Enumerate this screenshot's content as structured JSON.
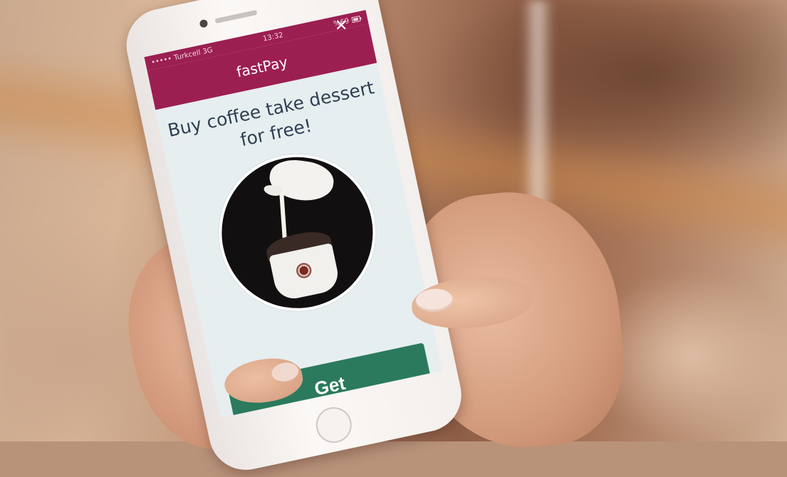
{
  "status_bar": {
    "carrier": "••••• Turkcell 3G",
    "time": "13:32",
    "battery": "%69"
  },
  "app": {
    "title": "fastPay",
    "close_glyph": "✕"
  },
  "promo": {
    "headline": "Buy coffee take dessert for free!",
    "image_name": "coffee-dessert-photo"
  },
  "actions": {
    "get_label": "Get"
  },
  "colors": {
    "header": "#9c1f52",
    "button": "#2b7a5d",
    "headline_text": "#2f3e52",
    "screen_bg": "#e6eef0"
  }
}
